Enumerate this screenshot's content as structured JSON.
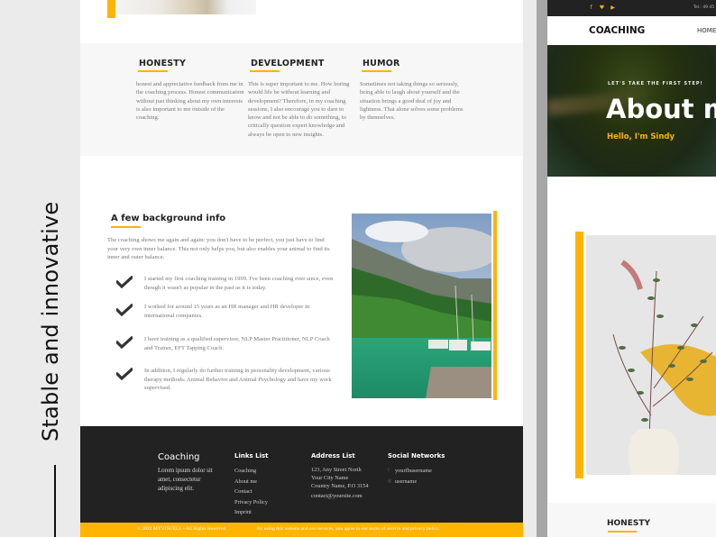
{
  "tagline": "Stable and innovative",
  "values": [
    {
      "title": "HONESTY",
      "text": "honest and appreciative feedback from me in the coaching process. Honest communication without just thinking about my own interests is also important to me outside of the coaching."
    },
    {
      "title": "DEVELOPMENT",
      "text": "This is super important to me. How boring would life be without learning and development? Therefore, in my coaching sessions, I also encourage you to dare to know and not be able to do something, to critically question expert knowledge and always be open to new insights."
    },
    {
      "title": "HUMOR",
      "text": "Sometimes not taking things so seriously, being able to laugh about yourself and the situation brings a good deal of joy and lightness. That alone solves some problems by themselves."
    }
  ],
  "background": {
    "title": "A few background info",
    "intro": "The coaching shows me again and again: you don't have to be perfect, you just have to find your very own inner balance. This not only helps you, but also enables your animal to find its inner and outer balance.",
    "items": [
      "I started my first coaching training in 1999. I've been coaching ever since, even though it wasn't as popular in the past as it is today.",
      "I worked for around 15 years as an HR manager and HR developer in international companies.",
      "I have training as a qualified supervisor, NLP Master Practitioner, NLP Coach and Trainer, EFT Tapping Coach.",
      "In addition, I regularly do further training in personality development, various therapy methods: Animal Behavior and Animal Psychology and have my work supervised."
    ]
  },
  "footer": {
    "brand": "Coaching",
    "description": "Lorem ipsum dolor sit amet, consectetur adipiscing elit.",
    "links_heading": "Links List",
    "links": [
      "Coaching",
      "About me",
      "Contact",
      "Privacy Policy",
      "Imprint"
    ],
    "address_heading": "Address List",
    "address_lines": [
      "123, Any Street North",
      "Your City Name",
      "Country Name, P.O 3154"
    ],
    "email": "contact@yoursite.com",
    "social_heading": "Social Networks",
    "social": [
      {
        "icon": "facebook-icon",
        "label": "yourfbusername"
      },
      {
        "icon": "instagram-icon",
        "label": "username"
      }
    ]
  },
  "copyright": {
    "left": "© 2022 MYVISUELL • All Rights Reserved",
    "right": "By using this website and our services, you agree to our terms of service and privacy policy."
  },
  "preview": {
    "tel": "Tel.: 49 45",
    "social_icons": [
      "facebook-icon",
      "twitter-icon",
      "youtube-icon"
    ],
    "logo": "COACHING",
    "nav_home": "HOME",
    "kicker": "LET'S TAKE THE FIRST STEP!",
    "title": "About me",
    "hello": "Hello, I'm Sindy",
    "section_title": "HONESTY"
  },
  "colors": {
    "accent": "#ffb400",
    "dark": "#222222"
  }
}
